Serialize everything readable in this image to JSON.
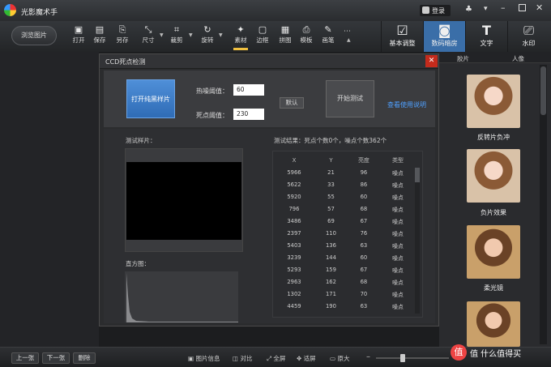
{
  "app": {
    "title": "光影魔术手"
  },
  "titlebar": {
    "login": "登录"
  },
  "toolbar": {
    "browse": "浏览图片",
    "tools": [
      {
        "label": "打开",
        "icon": "open-icon"
      },
      {
        "label": "保存",
        "icon": "save-icon"
      },
      {
        "label": "另存",
        "icon": "save-as-icon"
      },
      {
        "label": "尺寸",
        "icon": "resize-icon"
      },
      {
        "label": "裁剪",
        "icon": "crop-icon"
      },
      {
        "label": "旋转",
        "icon": "rotate-icon"
      },
      {
        "label": "素材",
        "icon": "material-icon"
      },
      {
        "label": "边框",
        "icon": "border-icon"
      },
      {
        "label": "拼图",
        "icon": "collage-icon"
      },
      {
        "label": "模板",
        "icon": "template-icon"
      },
      {
        "label": "画笔",
        "icon": "brush-icon"
      }
    ],
    "right_tabs": [
      {
        "label": "基本调整",
        "icon": "basic-adjust-icon"
      },
      {
        "label": "数码暗房",
        "icon": "darkroom-icon"
      },
      {
        "label": "文字",
        "icon": "text-icon"
      },
      {
        "label": "水印",
        "icon": "watermark-icon"
      }
    ]
  },
  "right_panel": {
    "tabs": [
      "胶片",
      "人像"
    ],
    "items": [
      "反转片负冲",
      "负片效果",
      "柔光镜"
    ]
  },
  "dialog": {
    "title": "CCD死点检测",
    "open_button": "打开纯黑样片",
    "hot_label": "热噪阈值：",
    "hot_value": "60",
    "dead_label": "死点阈值：",
    "dead_value": "230",
    "default_button": "默认",
    "start_button": "开始测试",
    "help_link": "查看使用说明",
    "sample_label": "测试样片：",
    "histogram_label": "直方图：",
    "result_text": "测试结果：死点个数0个，噪点个数362个",
    "columns": [
      "X",
      "Y",
      "亮度",
      "类型"
    ],
    "rows": [
      [
        "5966",
        "21",
        "96",
        "噪点"
      ],
      [
        "5622",
        "33",
        "86",
        "噪点"
      ],
      [
        "5920",
        "55",
        "60",
        "噪点"
      ],
      [
        "796",
        "57",
        "68",
        "噪点"
      ],
      [
        "3486",
        "69",
        "67",
        "噪点"
      ],
      [
        "2397",
        "110",
        "76",
        "噪点"
      ],
      [
        "5403",
        "136",
        "63",
        "噪点"
      ],
      [
        "3239",
        "144",
        "60",
        "噪点"
      ],
      [
        "5293",
        "159",
        "67",
        "噪点"
      ],
      [
        "2963",
        "162",
        "68",
        "噪点"
      ],
      [
        "1302",
        "171",
        "70",
        "噪点"
      ],
      [
        "4459",
        "190",
        "63",
        "噪点"
      ]
    ]
  },
  "bottombar": {
    "prev": "上一张",
    "next": "下一张",
    "delete": "删除",
    "info": "图片信息",
    "compare": "对比",
    "fullscreen": "全屏",
    "fit": "适屏",
    "original": "原大"
  },
  "watermark": "值 什么值得买"
}
